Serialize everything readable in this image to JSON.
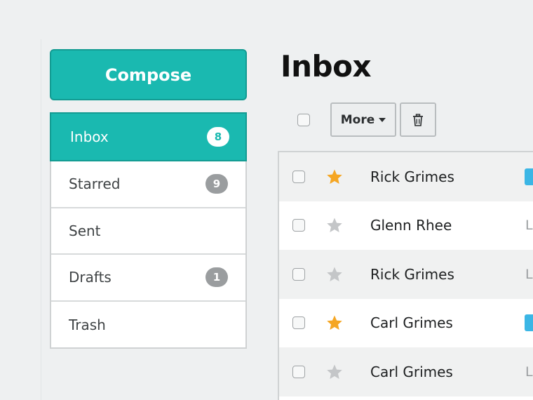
{
  "colors": {
    "accent": "#1ab9b0",
    "star_active": "#f5a623",
    "star_inactive": "#c4c6c8",
    "tag": "#3bb6e5",
    "badge": "#9a9d9f"
  },
  "compose": {
    "label": "Compose"
  },
  "sidebar": {
    "items": [
      {
        "label": "Inbox",
        "badge": "8",
        "active": true
      },
      {
        "label": "Starred",
        "badge": "9",
        "active": false
      },
      {
        "label": "Sent",
        "badge": "",
        "active": false
      },
      {
        "label": "Drafts",
        "badge": "1",
        "active": false
      },
      {
        "label": "Trash",
        "badge": "",
        "active": false
      }
    ]
  },
  "main": {
    "title": "Inbox",
    "toolbar": {
      "more_label": "More",
      "more_icon": "caret-down-icon",
      "delete_icon": "trash-icon"
    },
    "messages": [
      {
        "sender": "Rick Grimes",
        "starred": true,
        "snippet": "",
        "has_tag": true
      },
      {
        "sender": "Glenn Rhee",
        "starred": false,
        "snippet": "L",
        "has_tag": false
      },
      {
        "sender": "Rick Grimes",
        "starred": false,
        "snippet": "L",
        "has_tag": false
      },
      {
        "sender": "Carl Grimes",
        "starred": true,
        "snippet": "",
        "has_tag": true
      },
      {
        "sender": "Carl Grimes",
        "starred": false,
        "snippet": "L",
        "has_tag": false
      }
    ]
  }
}
